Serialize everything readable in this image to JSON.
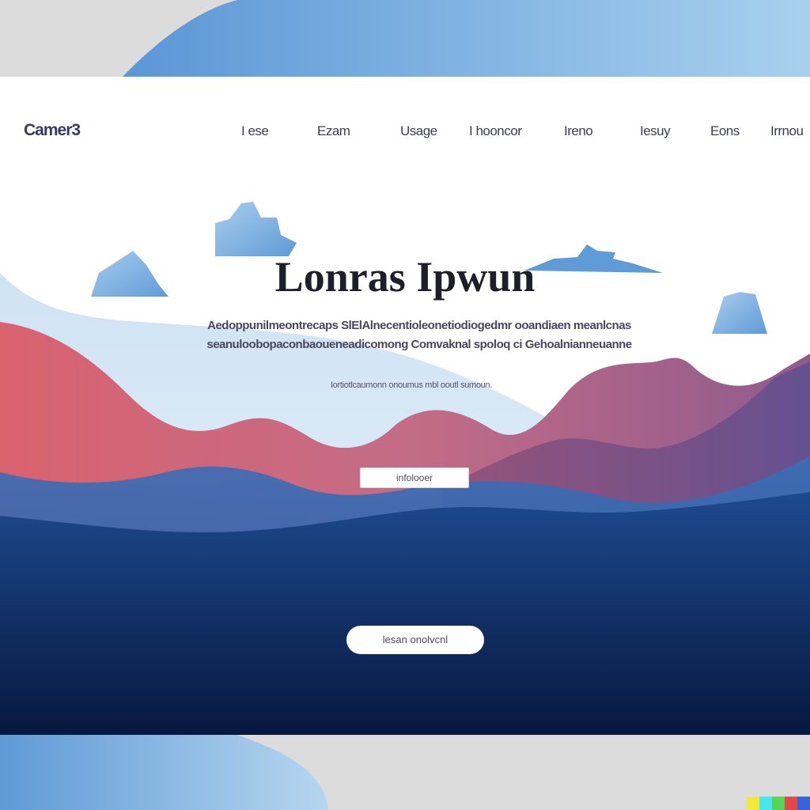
{
  "nav": {
    "logo": "Camer3",
    "items": [
      {
        "id": "home",
        "label": "I ese"
      },
      {
        "id": "eam",
        "label": "Ezam"
      },
      {
        "id": "usage",
        "label": "Usage"
      },
      {
        "id": "about",
        "label": "I hooncor"
      },
      {
        "id": "item5",
        "label": "Ireno"
      },
      {
        "id": "item6",
        "label": "Iesuy"
      },
      {
        "id": "item7",
        "label": "Eons"
      },
      {
        "id": "item8",
        "label": "Irrnou"
      }
    ]
  },
  "hero": {
    "title": "Lonras Ipwun",
    "description": "Aedoppunilmeontrecaps SlElAlnecentioleonetiodiogedmr ooandiaen meanlcnas seanuloobopaconbaoueneadicomong Comvaknal spoloq ci Gehoalnianneuanne",
    "subline": "Iortiotlcaumonn onoumus mbl ooutl sumoun.",
    "primary_button": "infolooer",
    "secondary_button": "lesan onolvcnl"
  },
  "colors": {
    "sky_top": "#6ea6dd",
    "mountain_red": "#d06070",
    "mountain_purple": "#9a5f86",
    "deep_navy": "#0b1f4d",
    "mid_blue": "#1f4f8f"
  },
  "icons": {
    "rock_1": "iceberg",
    "rock_2": "iceberg",
    "rock_3": "iceberg",
    "rock_4": "iceberg"
  },
  "watermark_colors": [
    "#f2e93a",
    "#49e6f2",
    "#57d45a",
    "#e24a4a",
    "#3a62d8"
  ]
}
